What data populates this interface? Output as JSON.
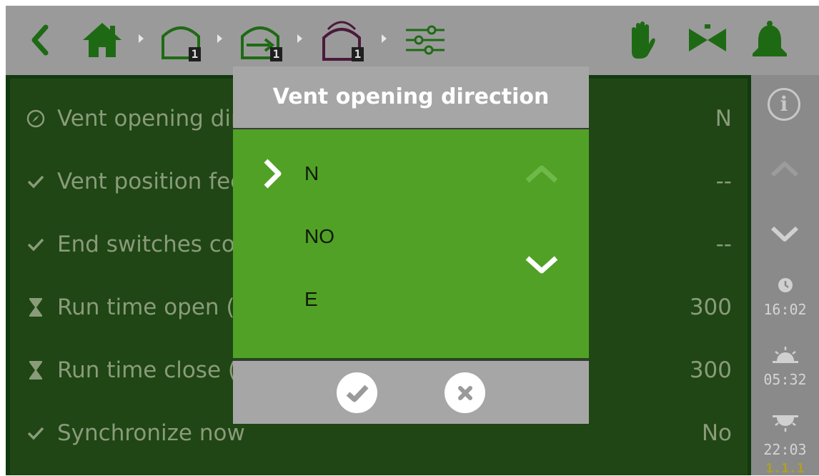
{
  "toolbar": {
    "badges": [
      "1",
      "1",
      "1"
    ],
    "colors": {
      "icon_green": "#1e6a14",
      "icon_purple": "#4a1a3a"
    },
    "icons": [
      "back-icon",
      "home-icon",
      "greenhouse-icon",
      "vent-icon",
      "roof-vent-icon",
      "settings-sliders-icon",
      "hand-icon",
      "valve-icon",
      "bell-icon"
    ]
  },
  "rows": [
    {
      "icon": "compass-icon",
      "label": "Vent opening direction",
      "value": "N"
    },
    {
      "icon": "check-icon",
      "label": "Vent position feedback",
      "value": "--"
    },
    {
      "icon": "check-icon",
      "label": "End switches connected",
      "value": "--"
    },
    {
      "icon": "hourglass-icon",
      "label": "Run time open (s)",
      "value": "300"
    },
    {
      "icon": "hourglass-icon",
      "label": "Run time close (s)",
      "value": "300"
    },
    {
      "icon": "check-icon",
      "label": "Synchronize now",
      "value": "No"
    }
  ],
  "right_panel": {
    "clock_time": "16:02",
    "sunrise_time": "05:32",
    "sunset_time": "22:03",
    "version": "1.1.1"
  },
  "dialog": {
    "title": "Vent opening direction",
    "options": [
      "N",
      "NO",
      "E"
    ],
    "selected": "N"
  }
}
